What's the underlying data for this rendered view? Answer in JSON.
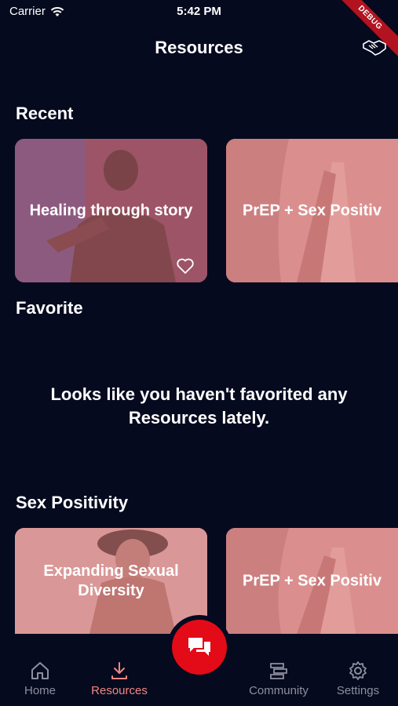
{
  "status": {
    "carrier": "Carrier",
    "time": "5:42 PM"
  },
  "debug_banner": "DEBUG",
  "header": {
    "title": "Resources"
  },
  "sections": {
    "recent": {
      "title": "Recent",
      "cards": [
        {
          "label": "Healing through story"
        },
        {
          "label": "PrEP + Sex Positiv"
        }
      ]
    },
    "favorite": {
      "title": "Favorite",
      "empty_message": "Looks like you haven't favorited any Resources lately."
    },
    "sex_positivity": {
      "title": "Sex Positivity",
      "cards": [
        {
          "label": "Expanding Sexual Diversity"
        },
        {
          "label": "PrEP + Sex Positiv"
        }
      ]
    }
  },
  "nav": {
    "items": [
      {
        "label": "Home",
        "icon": "home-icon"
      },
      {
        "label": "Resources",
        "icon": "download-icon",
        "active": true
      },
      {
        "label": "Community",
        "icon": "community-icon"
      },
      {
        "label": "Settings",
        "icon": "gear-icon"
      }
    ],
    "fab_icon": "chat-icon"
  },
  "colors": {
    "background": "#060a1f",
    "accent": "#e30b17",
    "active_nav": "#f08782"
  }
}
